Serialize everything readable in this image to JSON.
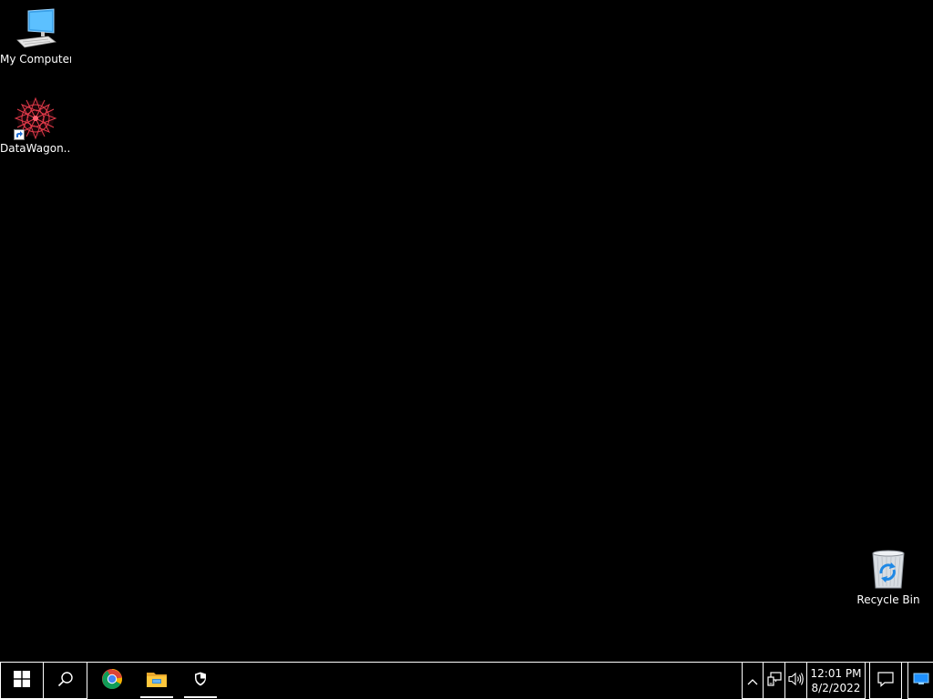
{
  "desktop": {
    "icons": [
      {
        "label": "My Computer",
        "icon": "computer-icon"
      },
      {
        "label": "DataWagon...",
        "icon": "datawagon-icon"
      },
      {
        "label": "Recycle Bin",
        "icon": "recycle-bin-icon"
      }
    ]
  },
  "taskbar": {
    "start": {
      "icon": "windows-logo-icon"
    },
    "search": {
      "icon": "search-icon"
    },
    "pinned": [
      {
        "icon": "chrome-icon",
        "running": false
      },
      {
        "icon": "file-explorer-icon",
        "running": true
      },
      {
        "icon": "shield-icon",
        "running": true
      }
    ],
    "tray": {
      "chevron_icon": "chevron-up-icon",
      "network_icon": "network-icon",
      "volume_icon": "volume-icon",
      "time": "12:01 PM",
      "date": "8/2/2022",
      "notifications_icon": "action-center-icon",
      "show_desktop_icon": "show-desktop-icon"
    }
  },
  "colors": {
    "background": "#000000",
    "taskbar_border": "#ffffff",
    "text": "#ffffff"
  }
}
